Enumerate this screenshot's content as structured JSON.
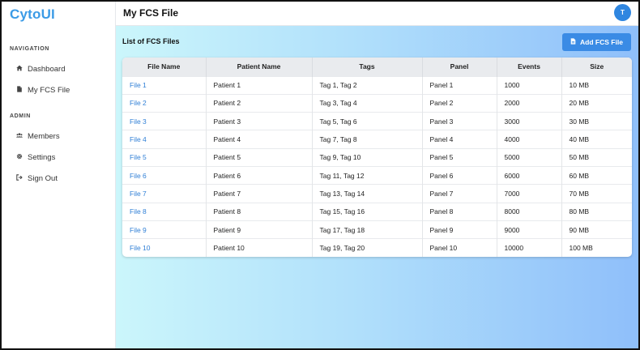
{
  "app": {
    "logo": "CytoUI"
  },
  "sidebar": {
    "sections": [
      {
        "heading": "NAVIGATION",
        "items": [
          {
            "label": "Dashboard",
            "icon": "home-icon"
          },
          {
            "label": "My FCS File",
            "icon": "file-icon"
          }
        ]
      },
      {
        "heading": "ADMIN",
        "items": [
          {
            "label": "Members",
            "icon": "users-icon"
          },
          {
            "label": "Settings",
            "icon": "gear-icon"
          },
          {
            "label": "Sign Out",
            "icon": "sign-out-icon"
          }
        ]
      }
    ]
  },
  "header": {
    "title": "My FCS File",
    "avatar_initial": "T"
  },
  "main": {
    "list_title": "List of FCS Files",
    "add_button_label": "Add FCS File",
    "columns": [
      "File Name",
      "Patient Name",
      "Tags",
      "Panel",
      "Events",
      "Size"
    ],
    "rows": [
      [
        "File 1",
        "Patient 1",
        "Tag 1, Tag 2",
        "Panel 1",
        "1000",
        "10 MB"
      ],
      [
        "File 2",
        "Patient 2",
        "Tag 3, Tag 4",
        "Panel 2",
        "2000",
        "20 MB"
      ],
      [
        "File 3",
        "Patient 3",
        "Tag 5, Tag 6",
        "Panel 3",
        "3000",
        "30 MB"
      ],
      [
        "File 4",
        "Patient 4",
        "Tag 7, Tag 8",
        "Panel 4",
        "4000",
        "40 MB"
      ],
      [
        "File 5",
        "Patient 5",
        "Tag 9, Tag 10",
        "Panel 5",
        "5000",
        "50 MB"
      ],
      [
        "File 6",
        "Patient 6",
        "Tag 11, Tag 12",
        "Panel 6",
        "6000",
        "60 MB"
      ],
      [
        "File 7",
        "Patient 7",
        "Tag 13, Tag 14",
        "Panel 7",
        "7000",
        "70 MB"
      ],
      [
        "File 8",
        "Patient 8",
        "Tag 15, Tag 16",
        "Panel 8",
        "8000",
        "80 MB"
      ],
      [
        "File 9",
        "Patient 9",
        "Tag 17, Tag 18",
        "Panel 9",
        "9000",
        "90 MB"
      ],
      [
        "File 10",
        "Patient 10",
        "Tag 19, Tag 20",
        "Panel 10",
        "10000",
        "100 MB"
      ]
    ]
  },
  "colors": {
    "accent": "#3a8be5",
    "link": "#2f7fd6",
    "logo": "#3b9be6"
  }
}
